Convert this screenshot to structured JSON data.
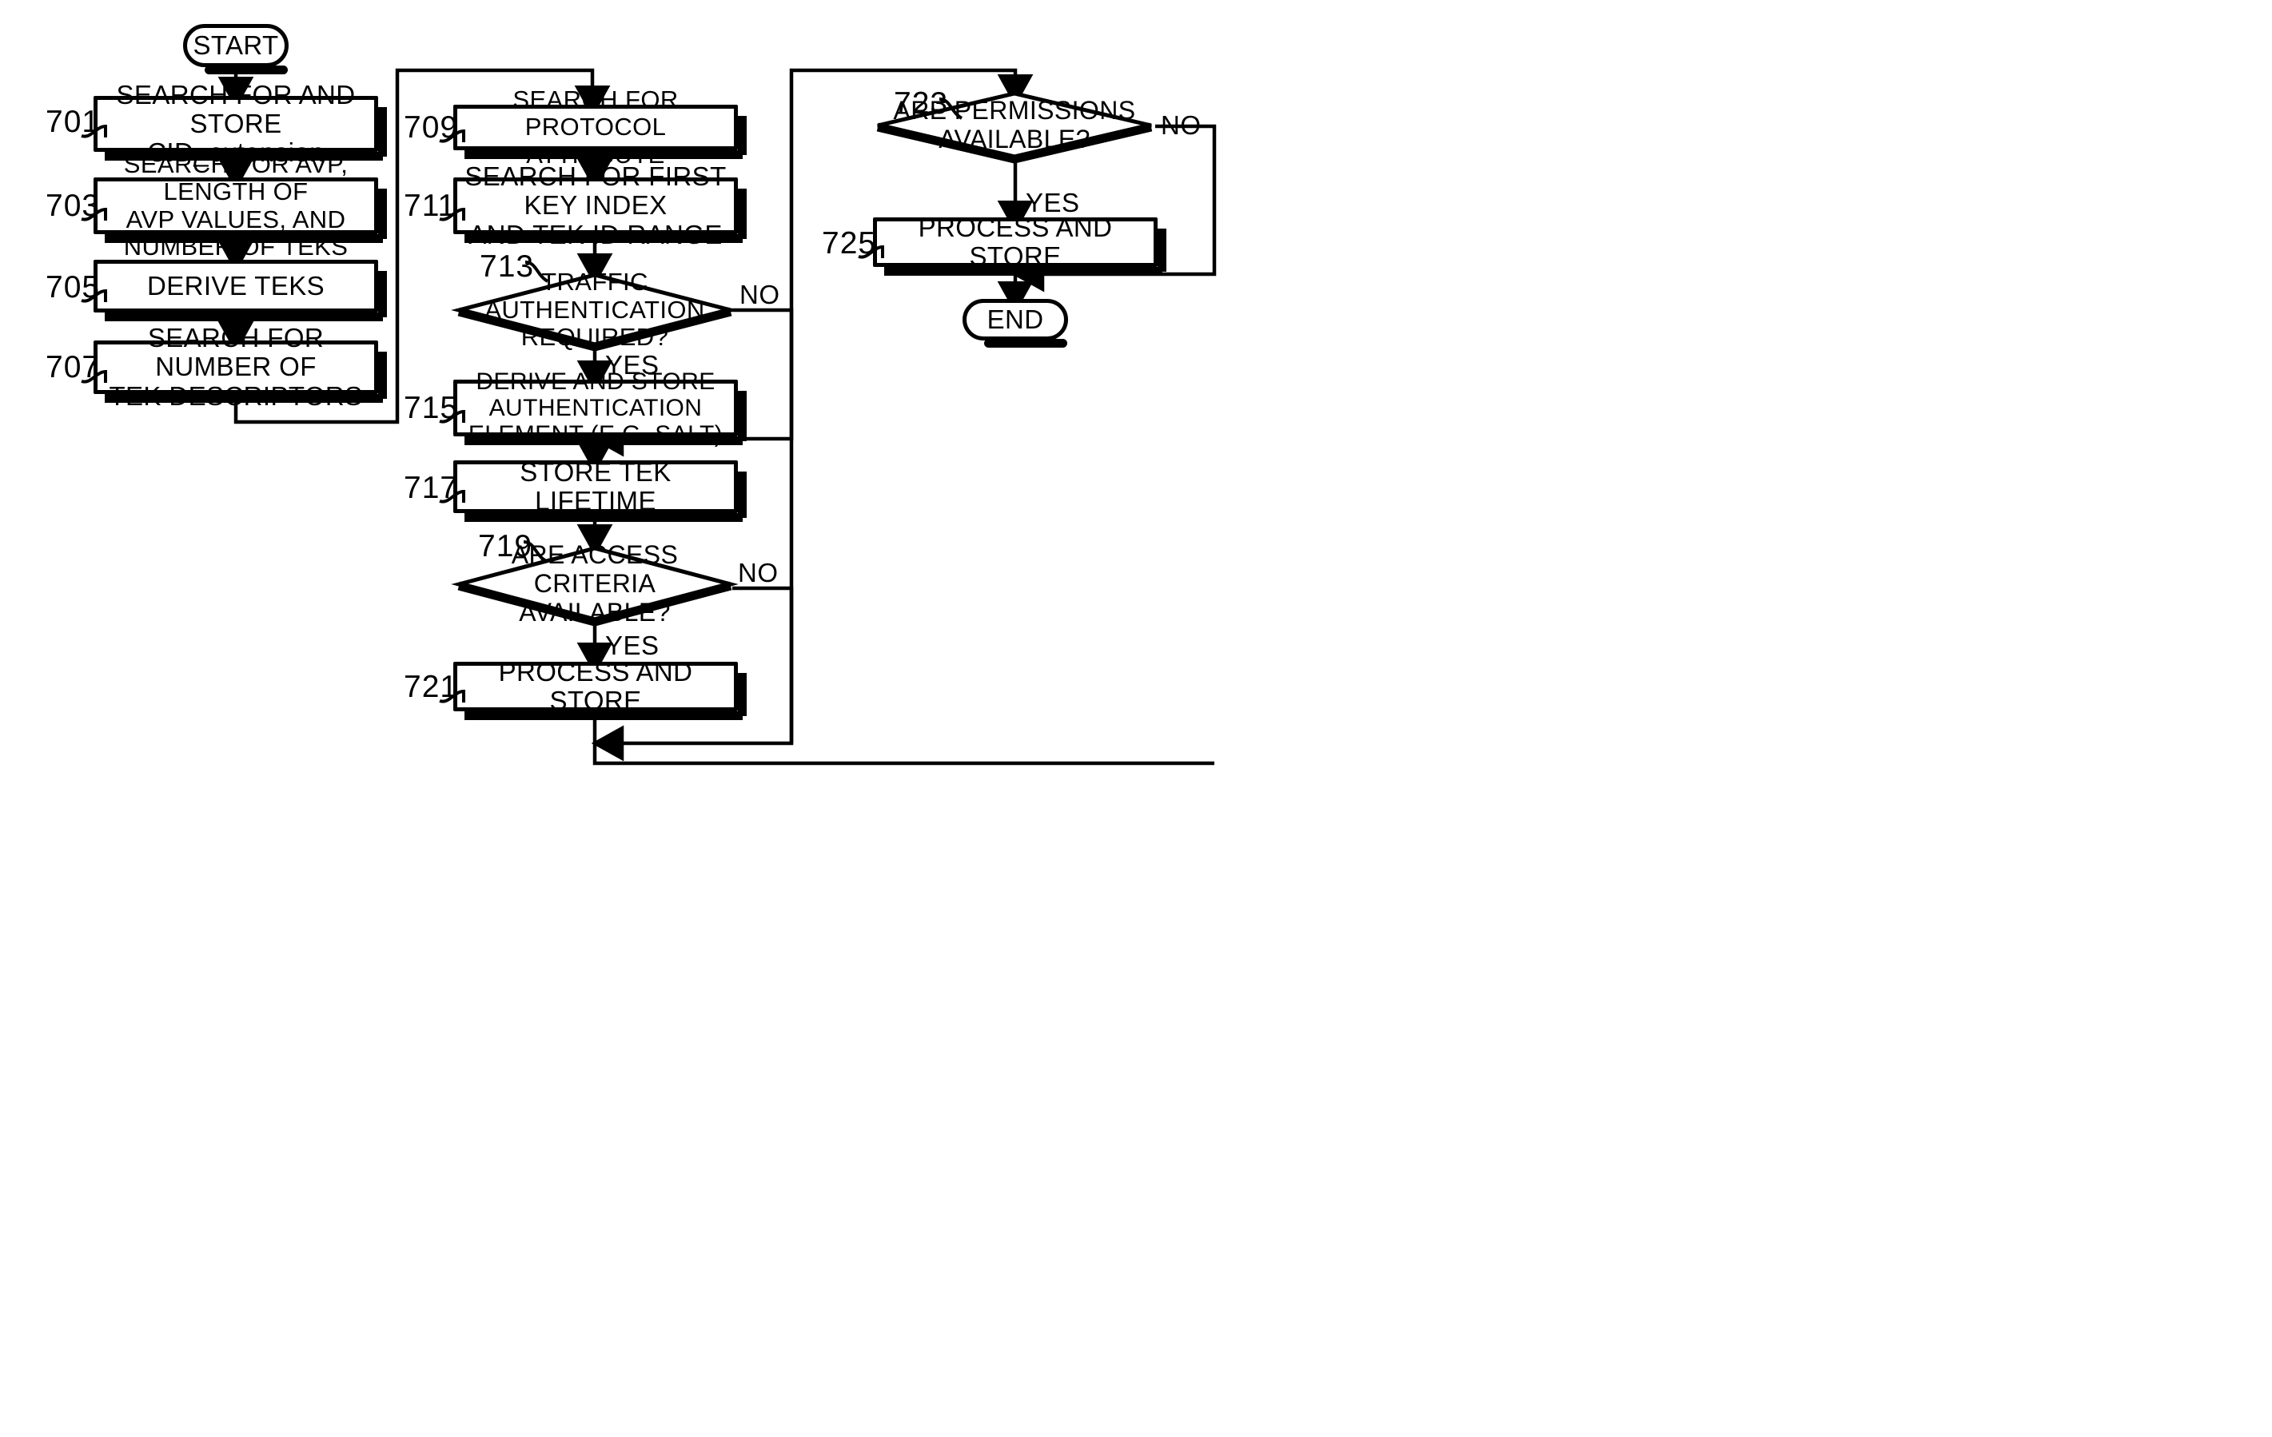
{
  "figure": {
    "type": "patent-flowchart",
    "orientation": "three-column",
    "stroke_color": "#000000",
    "background_color": "#FFFFFF"
  },
  "nodes": {
    "start": {
      "id": "start",
      "shape": "terminator",
      "label": "START"
    },
    "n701": {
      "id": "701",
      "shape": "process",
      "ref": "701",
      "label": "SEARCH FOR AND STORE\nCID_extension"
    },
    "n703": {
      "id": "703",
      "shape": "process",
      "ref": "703",
      "label": "SEARCH FOR AVP, LENGTH OF\nAVP VALUES, AND NUMBER OF TEKS"
    },
    "n705": {
      "id": "705",
      "shape": "process",
      "ref": "705",
      "label": "DERIVE TEKS"
    },
    "n707": {
      "id": "707",
      "shape": "process",
      "ref": "707",
      "label": "SEARCH FOR NUMBER OF\nTEK DESCRIPTORS"
    },
    "n709": {
      "id": "709",
      "shape": "process",
      "ref": "709",
      "label": "SEARCH FOR PROTOCOL ATTRIBUTE"
    },
    "n711": {
      "id": "711",
      "shape": "process",
      "ref": "711",
      "label": "SEARCH FOR FIRST KEY INDEX\nAND TEK ID RANGE"
    },
    "n713": {
      "id": "713",
      "shape": "decision",
      "ref": "713",
      "label": "TRAFFIC AUTHENTICATION\nREQUIRED?"
    },
    "n715": {
      "id": "715",
      "shape": "process",
      "ref": "715",
      "label": "DERIVE AND STORE AUTHENTICATION\nELEMENT (E.G. SALT)"
    },
    "n717": {
      "id": "717",
      "shape": "process",
      "ref": "717",
      "label": "STORE TEK LIFETIME"
    },
    "n719": {
      "id": "719",
      "shape": "decision",
      "ref": "719",
      "label": "ARE ACCESS CRITERIA\nAVAILABLE?"
    },
    "n721": {
      "id": "721",
      "shape": "process",
      "ref": "721",
      "label": "PROCESS AND STORE"
    },
    "n723": {
      "id": "723",
      "shape": "decision",
      "ref": "723",
      "label": "ARE PERMISSIONS\nAVAILABLE?"
    },
    "n725": {
      "id": "725",
      "shape": "process",
      "ref": "725",
      "label": "PROCESS AND STORE"
    },
    "end": {
      "id": "end",
      "shape": "terminator",
      "label": "END"
    }
  },
  "edge_labels": {
    "e713_no": "NO",
    "e713_yes": "YES",
    "e719_no": "NO",
    "e719_yes": "YES",
    "e723_no": "NO",
    "e723_yes": "YES"
  },
  "flow": [
    {
      "from": "start",
      "to": "701"
    },
    {
      "from": "701",
      "to": "703"
    },
    {
      "from": "703",
      "to": "705"
    },
    {
      "from": "705",
      "to": "707"
    },
    {
      "from": "707",
      "to": "709",
      "routing": "down-left-up-right"
    },
    {
      "from": "709",
      "to": "711"
    },
    {
      "from": "711",
      "to": "713"
    },
    {
      "from": "713",
      "to": "715",
      "label": "YES"
    },
    {
      "from": "713",
      "to": "717",
      "label": "NO",
      "routing": "right-down-in"
    },
    {
      "from": "715",
      "to": "717"
    },
    {
      "from": "717",
      "to": "719"
    },
    {
      "from": "719",
      "to": "721",
      "label": "YES"
    },
    {
      "from": "719",
      "to": "723",
      "label": "NO",
      "routing": "right-down-left-up"
    },
    {
      "from": "721",
      "to": "723",
      "routing": "down-right-up"
    },
    {
      "from": "723",
      "to": "725",
      "label": "YES"
    },
    {
      "from": "723",
      "to": "end",
      "label": "NO",
      "routing": "right-down-in"
    },
    {
      "from": "725",
      "to": "end"
    }
  ]
}
